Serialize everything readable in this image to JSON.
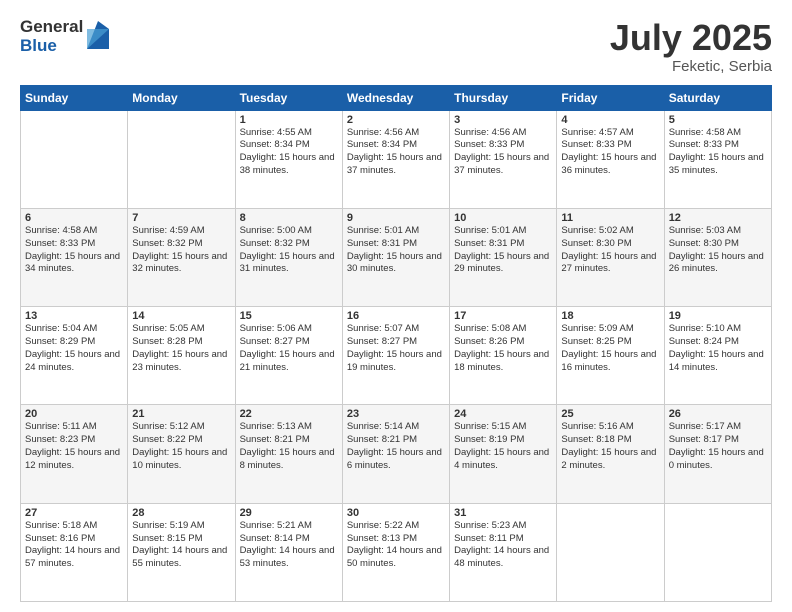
{
  "header": {
    "logo_general": "General",
    "logo_blue": "Blue",
    "month_year": "July 2025",
    "location": "Feketic, Serbia"
  },
  "weekdays": [
    "Sunday",
    "Monday",
    "Tuesday",
    "Wednesday",
    "Thursday",
    "Friday",
    "Saturday"
  ],
  "weeks": [
    [
      null,
      null,
      {
        "day": 1,
        "sunrise": "4:55 AM",
        "sunset": "8:34 PM",
        "daylight": "15 hours and 38 minutes."
      },
      {
        "day": 2,
        "sunrise": "4:56 AM",
        "sunset": "8:34 PM",
        "daylight": "15 hours and 37 minutes."
      },
      {
        "day": 3,
        "sunrise": "4:56 AM",
        "sunset": "8:33 PM",
        "daylight": "15 hours and 37 minutes."
      },
      {
        "day": 4,
        "sunrise": "4:57 AM",
        "sunset": "8:33 PM",
        "daylight": "15 hours and 36 minutes."
      },
      {
        "day": 5,
        "sunrise": "4:58 AM",
        "sunset": "8:33 PM",
        "daylight": "15 hours and 35 minutes."
      }
    ],
    [
      {
        "day": 6,
        "sunrise": "4:58 AM",
        "sunset": "8:33 PM",
        "daylight": "15 hours and 34 minutes."
      },
      {
        "day": 7,
        "sunrise": "4:59 AM",
        "sunset": "8:32 PM",
        "daylight": "15 hours and 32 minutes."
      },
      {
        "day": 8,
        "sunrise": "5:00 AM",
        "sunset": "8:32 PM",
        "daylight": "15 hours and 31 minutes."
      },
      {
        "day": 9,
        "sunrise": "5:01 AM",
        "sunset": "8:31 PM",
        "daylight": "15 hours and 30 minutes."
      },
      {
        "day": 10,
        "sunrise": "5:01 AM",
        "sunset": "8:31 PM",
        "daylight": "15 hours and 29 minutes."
      },
      {
        "day": 11,
        "sunrise": "5:02 AM",
        "sunset": "8:30 PM",
        "daylight": "15 hours and 27 minutes."
      },
      {
        "day": 12,
        "sunrise": "5:03 AM",
        "sunset": "8:30 PM",
        "daylight": "15 hours and 26 minutes."
      }
    ],
    [
      {
        "day": 13,
        "sunrise": "5:04 AM",
        "sunset": "8:29 PM",
        "daylight": "15 hours and 24 minutes."
      },
      {
        "day": 14,
        "sunrise": "5:05 AM",
        "sunset": "8:28 PM",
        "daylight": "15 hours and 23 minutes."
      },
      {
        "day": 15,
        "sunrise": "5:06 AM",
        "sunset": "8:27 PM",
        "daylight": "15 hours and 21 minutes."
      },
      {
        "day": 16,
        "sunrise": "5:07 AM",
        "sunset": "8:27 PM",
        "daylight": "15 hours and 19 minutes."
      },
      {
        "day": 17,
        "sunrise": "5:08 AM",
        "sunset": "8:26 PM",
        "daylight": "15 hours and 18 minutes."
      },
      {
        "day": 18,
        "sunrise": "5:09 AM",
        "sunset": "8:25 PM",
        "daylight": "15 hours and 16 minutes."
      },
      {
        "day": 19,
        "sunrise": "5:10 AM",
        "sunset": "8:24 PM",
        "daylight": "15 hours and 14 minutes."
      }
    ],
    [
      {
        "day": 20,
        "sunrise": "5:11 AM",
        "sunset": "8:23 PM",
        "daylight": "15 hours and 12 minutes."
      },
      {
        "day": 21,
        "sunrise": "5:12 AM",
        "sunset": "8:22 PM",
        "daylight": "15 hours and 10 minutes."
      },
      {
        "day": 22,
        "sunrise": "5:13 AM",
        "sunset": "8:21 PM",
        "daylight": "15 hours and 8 minutes."
      },
      {
        "day": 23,
        "sunrise": "5:14 AM",
        "sunset": "8:21 PM",
        "daylight": "15 hours and 6 minutes."
      },
      {
        "day": 24,
        "sunrise": "5:15 AM",
        "sunset": "8:19 PM",
        "daylight": "15 hours and 4 minutes."
      },
      {
        "day": 25,
        "sunrise": "5:16 AM",
        "sunset": "8:18 PM",
        "daylight": "15 hours and 2 minutes."
      },
      {
        "day": 26,
        "sunrise": "5:17 AM",
        "sunset": "8:17 PM",
        "daylight": "15 hours and 0 minutes."
      }
    ],
    [
      {
        "day": 27,
        "sunrise": "5:18 AM",
        "sunset": "8:16 PM",
        "daylight": "14 hours and 57 minutes."
      },
      {
        "day": 28,
        "sunrise": "5:19 AM",
        "sunset": "8:15 PM",
        "daylight": "14 hours and 55 minutes."
      },
      {
        "day": 29,
        "sunrise": "5:21 AM",
        "sunset": "8:14 PM",
        "daylight": "14 hours and 53 minutes."
      },
      {
        "day": 30,
        "sunrise": "5:22 AM",
        "sunset": "8:13 PM",
        "daylight": "14 hours and 50 minutes."
      },
      {
        "day": 31,
        "sunrise": "5:23 AM",
        "sunset": "8:11 PM",
        "daylight": "14 hours and 48 minutes."
      },
      null,
      null
    ]
  ]
}
